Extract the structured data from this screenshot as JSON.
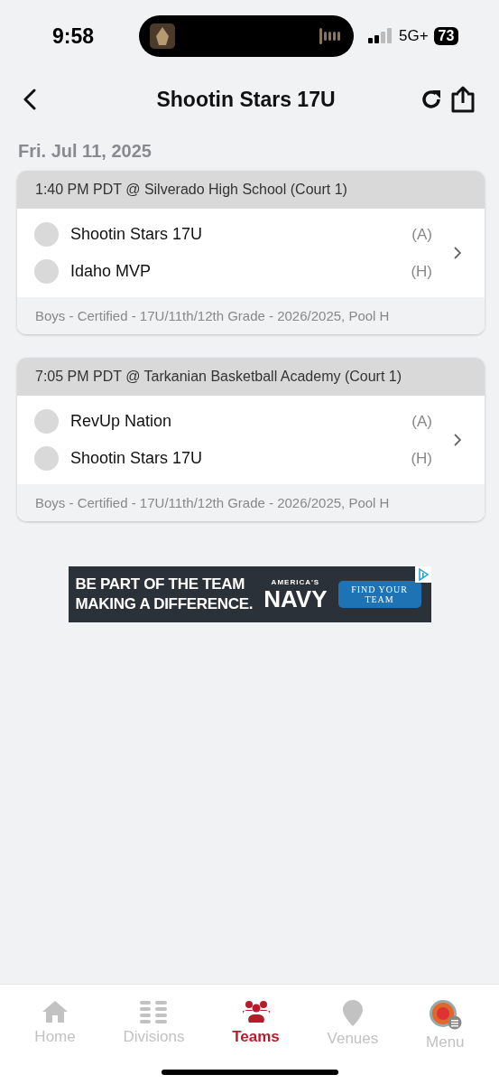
{
  "status_bar": {
    "time": "9:58",
    "network": "5G+",
    "battery": "73"
  },
  "header": {
    "title": "Shootin Stars 17U"
  },
  "date": "Fri. Jul 11, 2025",
  "games": [
    {
      "heading": "1:40 PM PDT @ Silverado High School (Court 1)",
      "teams": [
        {
          "name": "Shootin Stars 17U",
          "side": "(A)"
        },
        {
          "name": "Idaho MVP",
          "side": "(H)"
        }
      ],
      "division": "Boys - Certified - 17U/11th/12th Grade - 2026/2025, Pool H"
    },
    {
      "heading": "7:05 PM PDT @ Tarkanian Basketball Academy (Court 1)",
      "teams": [
        {
          "name": "RevUp Nation",
          "side": "(A)"
        },
        {
          "name": "Shootin Stars 17U",
          "side": "(H)"
        }
      ],
      "division": "Boys - Certified - 17U/11th/12th Grade - 2026/2025, Pool H"
    }
  ],
  "ad": {
    "headline": [
      "BE PART OF THE TEAM",
      "MAKING A DIFFERENCE."
    ],
    "brand_top": "AMERICA'S",
    "brand": "NAVY",
    "cta": "FIND YOUR TEAM"
  },
  "tabs": [
    {
      "kind": "home",
      "label": "Home",
      "selected": false
    },
    {
      "kind": "divisions",
      "label": "Divisions",
      "selected": false
    },
    {
      "kind": "teams",
      "label": "Teams",
      "selected": true
    },
    {
      "kind": "venues",
      "label": "Venues",
      "selected": false
    },
    {
      "kind": "menu",
      "label": "Menu",
      "selected": false
    }
  ]
}
